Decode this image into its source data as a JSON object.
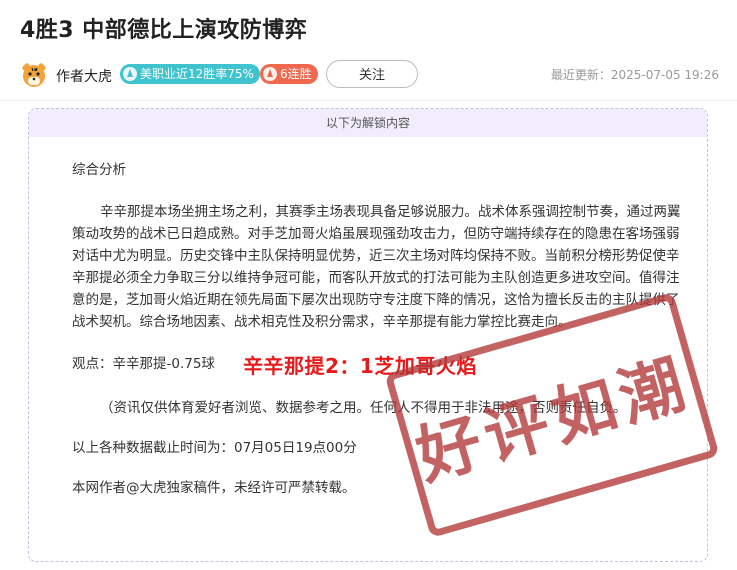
{
  "header": {
    "title": "4胜3 中部德比上演攻防博弈"
  },
  "author": {
    "name": "作者大虎",
    "avatar_icon": "tiger-avatar-icon",
    "badges": [
      {
        "label": "美职业近12胜率75%",
        "color": "#3fc3cf",
        "icon": "trend-up-icon"
      },
      {
        "label": "6连胜",
        "color": "#f0694f",
        "icon": "trend-up-icon"
      }
    ],
    "follow_label": "关注",
    "updated": "最近更新：2025-07-05 19:26"
  },
  "locked": {
    "header": "以下为解锁内容",
    "section_title": "综合分析",
    "analysis": "辛辛那提本场坐拥主场之利，其赛季主场表现具备足够说服力。战术体系强调控制节奏，通过两翼策动攻势的战术已日趋成熟。对手芝加哥火焰虽展现强劲攻击力，但防守端持续存在的隐患在客场强弱对话中尤为明显。历史交锋中主队保持明显优势，近三次主场对阵均保持不败。当前积分榜形势促使辛辛那提必须全力争取三分以维持争冠可能，而客队开放式的打法可能为主队创造更多进攻空间。值得注意的是，芝加哥火焰近期在领先局面下屡次出现防守专注度下降的情况，这恰为擅长反击的主队提供了战术契机。综合场地因素、战术相克性及积分需求，辛辛那提有能力掌控比赛走向。",
    "viewpoint": "观点：辛辛那提-0.75球",
    "prediction": "辛辛那提2：1芝加哥火焰",
    "disclaimer": "（资讯仅供体育爱好者浏览、数据参考之用。任何人不得用于非法用途，否则责任自负。",
    "data_cutoff": "以上各种数据截止时间为：07月05日19点00分",
    "copyright": "本网作者@大虎独家稿件，未经许可严禁转载。",
    "stamp": "好评如潮"
  },
  "colors": {
    "accent_red": "#e8191a",
    "stamp_red": "#b33737",
    "locked_bg": "#f1edfc"
  }
}
